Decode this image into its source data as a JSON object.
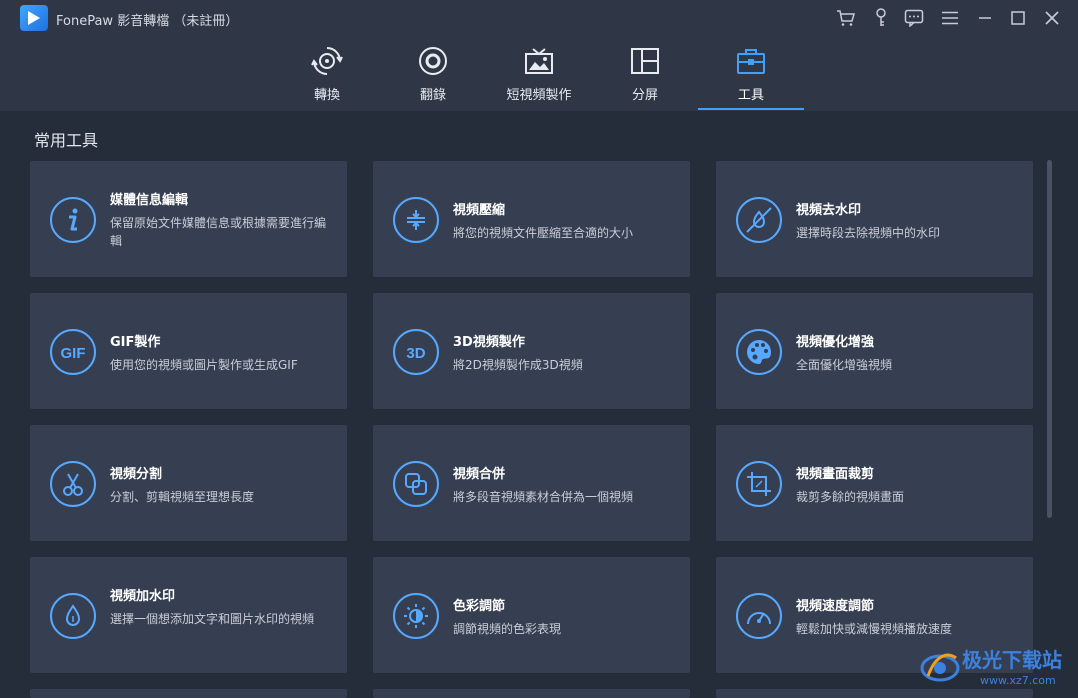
{
  "window": {
    "title": "FonePaw 影音轉檔 （未註冊）",
    "controls": [
      "cart-icon",
      "key-icon",
      "feedback-icon",
      "menu-icon",
      "minimize-icon",
      "maximize-icon",
      "close-icon"
    ]
  },
  "nav": {
    "tabs": [
      {
        "label": "轉換",
        "icon": "convert-icon"
      },
      {
        "label": "翻錄",
        "icon": "rip-disc-icon"
      },
      {
        "label": "短視頻製作",
        "icon": "tv-image-icon"
      },
      {
        "label": "分屏",
        "icon": "split-screen-icon"
      },
      {
        "label": "工具",
        "icon": "toolbox-icon",
        "active": true
      }
    ]
  },
  "section": {
    "title": "常用工具"
  },
  "cards": [
    {
      "title": "媒體信息編輯",
      "desc": "保留原始文件媒體信息或根據需要進行編輯",
      "icon": "info-icon"
    },
    {
      "title": "視頻壓縮",
      "desc": "將您的視頻文件壓縮至合適的大小",
      "icon": "compress-icon"
    },
    {
      "title": "視頻去水印",
      "desc": "選擇時段去除視頻中的水印",
      "icon": "remove-watermark-icon"
    },
    {
      "title": "GIF製作",
      "desc": "使用您的視頻或圖片製作或生成GIF",
      "icon": "gif-icon"
    },
    {
      "title": "3D視頻製作",
      "desc": "將2D視頻製作成3D視頻",
      "icon": "3d-icon"
    },
    {
      "title": "視頻優化增強",
      "desc": "全面優化增強視頻",
      "icon": "palette-icon"
    },
    {
      "title": "視頻分割",
      "desc": "分割、剪輯視頻至理想長度",
      "icon": "scissors-icon"
    },
    {
      "title": "視頻合併",
      "desc": "將多段音視頻素材合併為一個視頻",
      "icon": "merge-icon"
    },
    {
      "title": "視頻畫面裁剪",
      "desc": "裁剪多餘的視頻畫面",
      "icon": "crop-icon"
    },
    {
      "title": "視頻加水印",
      "desc": "選擇一個想添加文字和圖片水印的視頻",
      "icon": "add-watermark-icon"
    },
    {
      "title": "色彩調節",
      "desc": "調節視頻的色彩表現",
      "icon": "brightness-icon"
    },
    {
      "title": "視頻速度調節",
      "desc": "輕鬆加快或減慢視頻播放速度",
      "icon": "speed-icon"
    }
  ],
  "watermark": {
    "text": "极光下载站",
    "url": "www.xz7.com"
  },
  "colors": {
    "accent": "#3fa0ff",
    "background": "#252d3a",
    "card": "#363f51",
    "bar": "#2f3747"
  }
}
